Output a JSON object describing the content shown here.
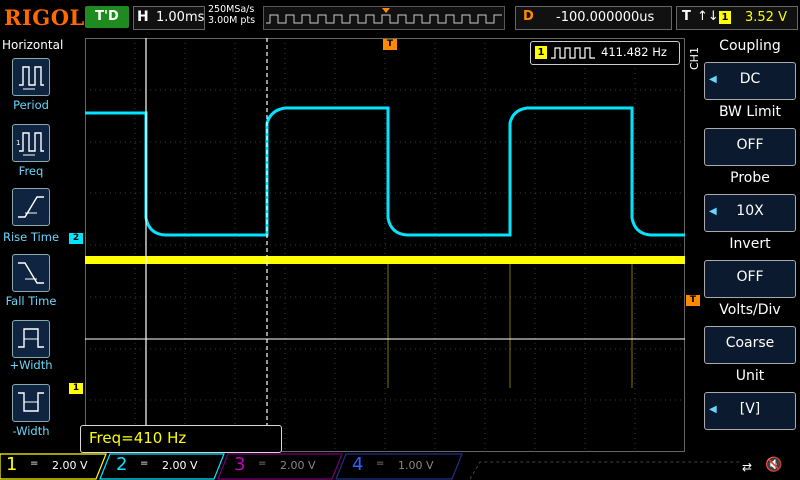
{
  "top": {
    "logo": "RIGOL",
    "run_state": "T'D",
    "horizontal_label": "H",
    "timebase": "1.00ms",
    "sample_rate": "250MSa/s",
    "memory_depth": "3.00M pts",
    "delay_label": "D",
    "delay_value": "-100.000000us",
    "trigger_label": "T",
    "trigger_slope": "↑↓",
    "trigger_source": "1",
    "trigger_level": "3.52 V"
  },
  "left_menu": {
    "title": "Horizontal",
    "items": [
      {
        "label": "Period",
        "icon": "period-icon"
      },
      {
        "label": "Freq",
        "icon": "freq-icon"
      },
      {
        "label": "Rise Time",
        "icon": "rise-time-icon"
      },
      {
        "label": "Fall Time",
        "icon": "fall-time-icon"
      },
      {
        "label": "+Width",
        "icon": "positive-width-icon"
      },
      {
        "label": "-Width",
        "icon": "negative-width-icon"
      }
    ]
  },
  "measurement": {
    "channel": "1",
    "icon": "square-wave-icon",
    "value": "411.482 Hz"
  },
  "cursor_readout": "Freq=410 Hz",
  "markers": {
    "trigger_pos": "T",
    "ch2": "2",
    "ch1": "1",
    "trigger_level": "T"
  },
  "right_menu": {
    "channel_label": "CH1",
    "items": [
      {
        "title": "Coupling",
        "value": "DC",
        "has_arrow": true
      },
      {
        "title": "BW Limit",
        "value": "OFF",
        "has_arrow": false
      },
      {
        "title": "Probe",
        "value": "10X",
        "has_arrow": true
      },
      {
        "title": "Invert",
        "value": "OFF",
        "has_arrow": false
      },
      {
        "title": "Volts/Div",
        "value": "Coarse",
        "has_arrow": false
      },
      {
        "title": "Unit",
        "value": "[V]",
        "has_arrow": true
      }
    ]
  },
  "channels": [
    {
      "num": "1",
      "coupling": "=",
      "scale": "2.00 V",
      "color": "#ffff00",
      "active": true
    },
    {
      "num": "2",
      "coupling": "=",
      "scale": "2.00 V",
      "color": "#00e5ff",
      "active": true
    },
    {
      "num": "3",
      "coupling": "=",
      "scale": "2.00 V",
      "color": "#c000c0",
      "active": false
    },
    {
      "num": "4",
      "coupling": "=",
      "scale": "1.00 V",
      "color": "#3060ff",
      "active": false
    }
  ],
  "colors": {
    "ch1": "#ffff00",
    "ch2": "#00e5ff",
    "accent": "#ff8a00",
    "run": "#1f8a1f",
    "menu_text": "#6ad6ff"
  }
}
